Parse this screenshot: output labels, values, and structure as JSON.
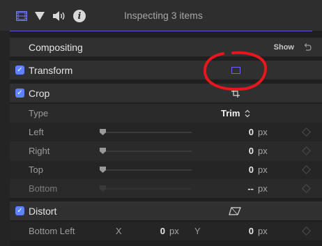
{
  "header": {
    "title": "Inspecting 3 items",
    "tabs": [
      {
        "icon": "film-icon"
      },
      {
        "icon": "filter-icon"
      },
      {
        "icon": "speaker-icon"
      },
      {
        "icon": "info-icon"
      }
    ]
  },
  "sections": {
    "compositing": {
      "label": "Compositing",
      "show_label": "Show"
    },
    "transform": {
      "label": "Transform",
      "checked": true
    },
    "crop": {
      "label": "Crop",
      "checked": true,
      "type": {
        "label": "Type",
        "value": "Trim"
      },
      "params": [
        {
          "label": "Left",
          "value": "0",
          "unit": "px"
        },
        {
          "label": "Right",
          "value": "0",
          "unit": "px"
        },
        {
          "label": "Top",
          "value": "0",
          "unit": "px"
        },
        {
          "label": "Bottom",
          "value": "--",
          "unit": "px"
        }
      ]
    },
    "distort": {
      "label": "Distort",
      "checked": true,
      "bottom_left": {
        "label": "Bottom Left",
        "x_label": "X",
        "x_value": "0",
        "x_unit": "px",
        "y_label": "Y",
        "y_value": "0",
        "y_unit": "px"
      }
    }
  },
  "colors": {
    "accent": "#5e83ff",
    "header_line": "#5a57c8",
    "annotation": "#e8161d"
  }
}
